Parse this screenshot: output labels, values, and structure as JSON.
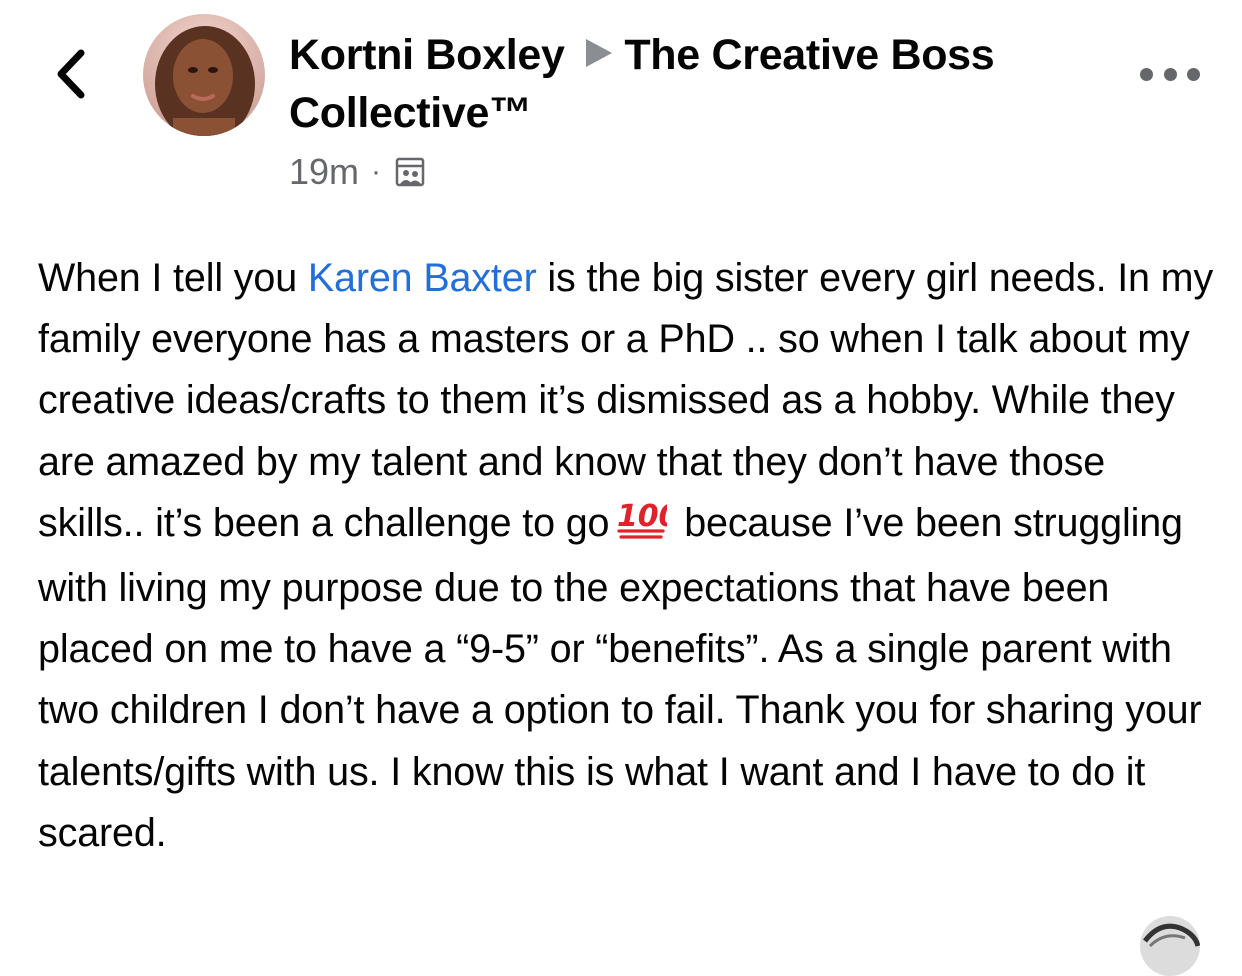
{
  "post": {
    "author": "Kortni Boxley",
    "group": "The Creative Boss Collective™",
    "time": "19m",
    "separator": "·",
    "audience_icon": "group-audience-icon",
    "body": {
      "part1": "When I tell you ",
      "mention": "Karen Baxter",
      "part2": " is the big sister every girl needs. In my family everyone has a masters or a PhD .. so when I talk about my creative ideas/crafts to them it’s dismissed as a hobby. While they are amazed by my talent and know that they don’t have those skills.. it’s been a challenge to go",
      "emoji": "💯",
      "part3": " because I’ve been struggling with living my purpose due to the expectations that have been placed on me to have a “9-5” or “benefits”. As a single parent with two children I don’t have a option to fail. Thank you for sharing your talents/gifts with us. I know this is what I want and I have to do it scared."
    }
  },
  "colors": {
    "mention": "#216fdb",
    "secondary_text": "#65676b",
    "arrow": "#8a8d91",
    "emoji_red": "#e0222b"
  },
  "icons": {
    "back": "chevron-left-icon",
    "more": "more-horizontal-icon"
  }
}
